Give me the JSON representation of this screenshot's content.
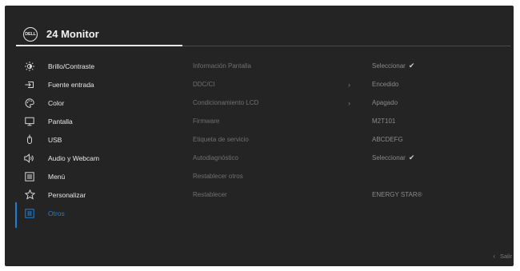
{
  "header": {
    "logo_text": "DELL",
    "title": "24 Monitor"
  },
  "sidebar": {
    "items": [
      {
        "label": "Brillo/Contraste",
        "icon": "brightness-icon"
      },
      {
        "label": "Fuente entrada",
        "icon": "input-source-icon"
      },
      {
        "label": "Color",
        "icon": "color-palette-icon"
      },
      {
        "label": "Pantalla",
        "icon": "display-icon"
      },
      {
        "label": "USB",
        "icon": "usb-icon"
      },
      {
        "label": "Audio y Webcam",
        "icon": "speaker-icon"
      },
      {
        "label": "Menú",
        "icon": "menu-icon"
      },
      {
        "label": "Personalizar",
        "icon": "star-icon"
      },
      {
        "label": "Otros",
        "icon": "others-icon",
        "active": true
      }
    ]
  },
  "submenu": {
    "items": [
      {
        "label": "Información Pantalla",
        "value": "Seleccionar",
        "value_check": true
      },
      {
        "label": "DDC/CI",
        "has_arrow": true,
        "value": "Encedido"
      },
      {
        "label": "Condicionamiento LCD",
        "has_arrow": true,
        "value": "Apagado"
      },
      {
        "label": "Firmware",
        "value": "M2T101"
      },
      {
        "label": "Etiqueta de servicio",
        "value": "ABCDEFG"
      },
      {
        "label": "Autodiagnóstico",
        "value": "Seleccionar",
        "value_check": true
      },
      {
        "label": "Restablecer otros",
        "value": ""
      },
      {
        "label": "Restablecer",
        "value": "ENERGY STAR®"
      }
    ]
  },
  "footer": {
    "exit_label": "Salir"
  },
  "colors": {
    "accent": "#1e7fd6",
    "background": "#242424"
  }
}
